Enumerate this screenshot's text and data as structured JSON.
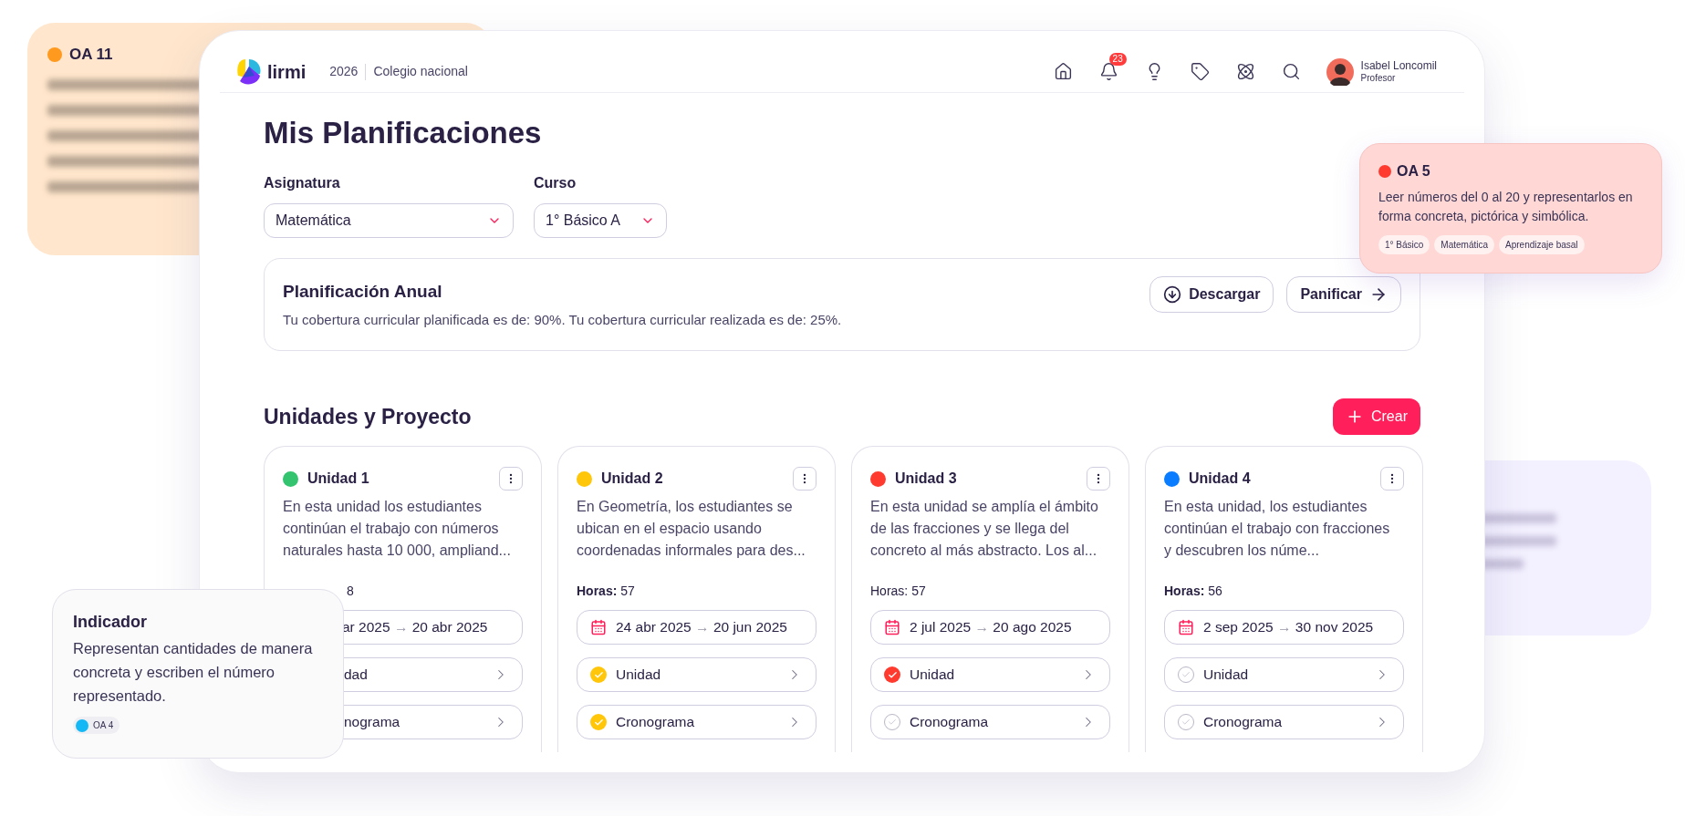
{
  "background_cards": [
    {
      "kind": "objective",
      "title": "OA 11",
      "color": "#ff9a1f"
    },
    {
      "kind": "plain"
    }
  ],
  "header": {
    "logo": "lirmi",
    "year": "2026",
    "school": "Colegio nacional",
    "notifications": "23",
    "user": {
      "name": "Isabel Loncomil",
      "role": "Profesor"
    }
  },
  "page_title": "Mis Planificaciones",
  "filters": [
    {
      "label": "Asignatura",
      "value": "Matemática"
    },
    {
      "label": "Curso",
      "value": "1° Básico A"
    }
  ],
  "annual": {
    "title": "Planificación Anual",
    "text": "Tu cobertura curricular planificada es de: 90%. Tu cobertura curricular realizada es de: 25%.",
    "buttons": [
      {
        "kind": "download",
        "label": "Descargar"
      },
      {
        "kind": "next",
        "label": "Panificar"
      }
    ]
  },
  "units_section": {
    "title": "Unidades y Proyecto",
    "create": "Crear"
  },
  "units": [
    {
      "title": "Unidad 1",
      "color": "#34c36f",
      "overlapped": true,
      "description": "En esta unidad los estudiantes continúan el trabajo con números naturales hasta 10 000, ampliand...",
      "hours": {
        "value": "8"
      },
      "start": "ar 2025",
      "arrow": "→",
      "end": "20 abr 2025",
      "items": [
        {
          "label": "dad"
        },
        {
          "label": "nograma"
        }
      ]
    },
    {
      "title": "Unidad 2",
      "color": "#ffc60a",
      "overlapped": false,
      "description": "En Geometría, los estudiantes se ubican en el espacio usando coordenadas informales para des...",
      "hours": {
        "label": "Horas:",
        "label_bold": true,
        "value": "57"
      },
      "start": "24 abr 2025",
      "arrow": "→",
      "end": "20 jun 2025",
      "items": [
        {
          "label": "Unidad",
          "checked": true
        },
        {
          "label": "Cronograma",
          "checked": true
        }
      ]
    },
    {
      "title": "Unidad 3",
      "color": "#ff3b2f",
      "overlapped": false,
      "description": "En esta unidad se amplía el ámbito de las fracciones y se llega del concreto al más abstracto. Los al...",
      "hours": {
        "label": "Horas:",
        "label_bold": false,
        "value": "57"
      },
      "start": "2 jul 2025",
      "arrow": "→",
      "end": "20 ago 2025",
      "items": [
        {
          "label": "Unidad",
          "checked": true
        },
        {
          "label": "Cronograma",
          "checked": false
        }
      ]
    },
    {
      "title": "Unidad 4",
      "color": "#0a7cff",
      "overlapped": false,
      "description": "En esta unidad, los estudiantes continúan el trabajo con fracciones y descubren los núme...",
      "hours": {
        "label": "Horas:",
        "label_bold": true,
        "value": "56"
      },
      "start": "2 sep 2025",
      "arrow": "→",
      "end": "30 nov 2025",
      "items": [
        {
          "label": "Unidad",
          "checked": false
        },
        {
          "label": "Cronograma",
          "checked": false
        }
      ]
    }
  ],
  "objective_card": {
    "title": "OA 5",
    "color": "#ff3b2f",
    "text": "Leer números del 0 al 20 y representarlos en forma concreta, pictórica y simbólica.",
    "tags": [
      "1° Básico",
      "Matemática",
      "Aprendizaje basal"
    ]
  },
  "indicator_card": {
    "title": "Indicador",
    "text": "Representan cantidades de manera concreta y escriben el número representado.",
    "tag": {
      "label": "OA 4",
      "color": "#14b8f5"
    }
  }
}
